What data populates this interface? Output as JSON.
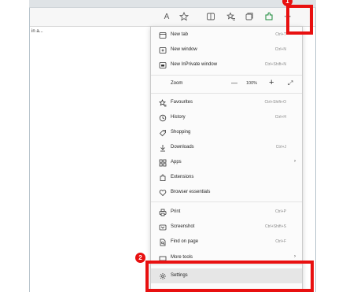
{
  "address": {
    "text": "in a..."
  },
  "toolbar": {
    "icons": [
      "read-aloud-icon",
      "favorite-star-icon",
      "split-screen-icon",
      "favorites-icon",
      "collections-icon",
      "extensions-icon",
      "more-dots-icon"
    ],
    "read_aloud_glyph": "A",
    "more_glyph": "···"
  },
  "menu": {
    "new_tab": {
      "label": "New tab",
      "shortcut": "Ctrl+T"
    },
    "new_window": {
      "label": "New window",
      "shortcut": "Ctrl+N"
    },
    "new_inprivate": {
      "label": "New InPrivate window",
      "shortcut": "Ctrl+Shift+N"
    },
    "zoom": {
      "label": "Zoom",
      "minus": "—",
      "value": "100%",
      "plus": "+",
      "expand": "⤢"
    },
    "favourites": {
      "label": "Favourites",
      "shortcut": "Ctrl+Shift+O"
    },
    "history": {
      "label": "History",
      "shortcut": "Ctrl+H"
    },
    "shopping": {
      "label": "Shopping"
    },
    "downloads": {
      "label": "Downloads",
      "shortcut": "Ctrl+J"
    },
    "apps": {
      "label": "Apps",
      "arrow": "›"
    },
    "extensions": {
      "label": "Extensions"
    },
    "browser_essentials": {
      "label": "Browser essentials"
    },
    "print": {
      "label": "Print",
      "shortcut": "Ctrl+P"
    },
    "screenshot": {
      "label": "Screenshot",
      "shortcut": "Ctrl+Shift+S"
    },
    "find_on_page": {
      "label": "Find on page",
      "shortcut": "Ctrl+F"
    },
    "more_tools": {
      "label": "More tools",
      "arrow": "›"
    },
    "settings": {
      "label": "Settings"
    }
  },
  "annotations": {
    "badge_1": "1",
    "badge_2": "2",
    "color": "#e81010"
  }
}
